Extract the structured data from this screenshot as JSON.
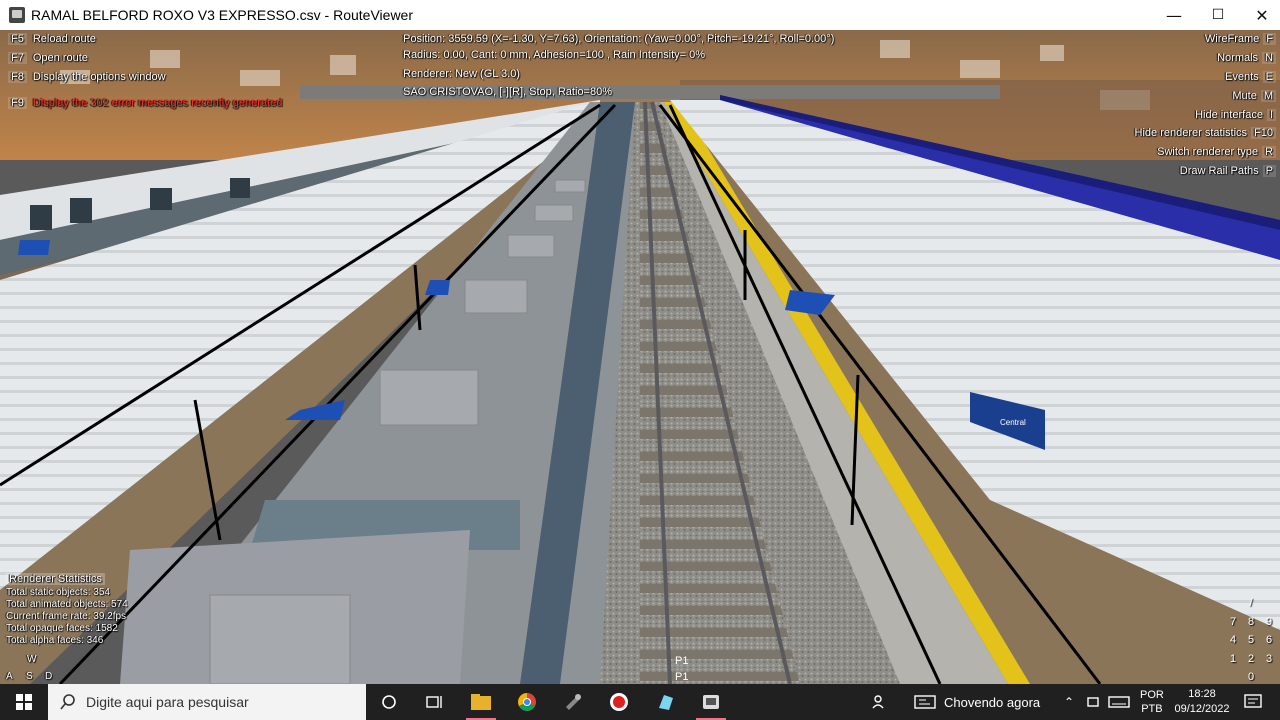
{
  "window": {
    "title": "RAMAL BELFORD ROXO V3 EXPRESSO.csv - RouteViewer",
    "minimize": "—",
    "maximize": "☐",
    "close": "✕"
  },
  "left_menu": [
    {
      "key": "F5",
      "label": "Reload route"
    },
    {
      "key": "F7",
      "label": "Open route"
    },
    {
      "key": "F8",
      "label": "Display the options window"
    }
  ],
  "error_line": {
    "key": "F9",
    "label": "Display the 302 error messages recently generated"
  },
  "info": {
    "position": "Position: 3559.59 (X=-1.30, Y=7.63), Orientation: (Yaw=0.00°, Pitch=-19.21°, Roll=0.00°)",
    "radius": "Radius: 0.00, Cant: 0 mm, Adhesion=100 , Rain Intensity= 0%",
    "renderer": "Renderer: New (GL 3.0)",
    "station": "SAO CRISTOVAO, [-][R], Stop, Ratio=80%"
  },
  "right_menu": [
    {
      "label": "WireFrame",
      "key": "F"
    },
    {
      "label": "Normals",
      "key": "N"
    },
    {
      "label": "Events",
      "key": "E"
    },
    {
      "label": "Mute",
      "key": "M"
    },
    {
      "label": "Hide interface",
      "key": "I"
    },
    {
      "label": "Hide renderer statistics",
      "key": "F10"
    },
    {
      "label": "Switch renderer type",
      "key": "R"
    },
    {
      "label": "Draw Rail Paths",
      "key": "P"
    }
  ],
  "stats": {
    "title": "Renderer Statistics",
    "lines": [
      "Total static objects: 354",
      "Total animated objects: 574",
      "Current frame rate: 39.2fps",
      "Total opaque faces: 1582",
      "Total alpha faces: 346"
    ]
  },
  "wasd": {
    "w": "W",
    "a": "A",
    "s": "S",
    "d": "D"
  },
  "numpad": [
    "/",
    "7",
    "8",
    "9",
    "4",
    "5",
    "6",
    "1",
    "2",
    "3",
    "0"
  ],
  "scene_labels": {
    "p1a": "P1",
    "p1b": "P1",
    "sign": "Central"
  },
  "taskbar": {
    "search_placeholder": "Digite aqui para pesquisar",
    "weather": "Chovendo agora",
    "lang_top": "POR",
    "lang_bottom": "PTB",
    "time": "18:28",
    "date": "09/12/2022"
  }
}
